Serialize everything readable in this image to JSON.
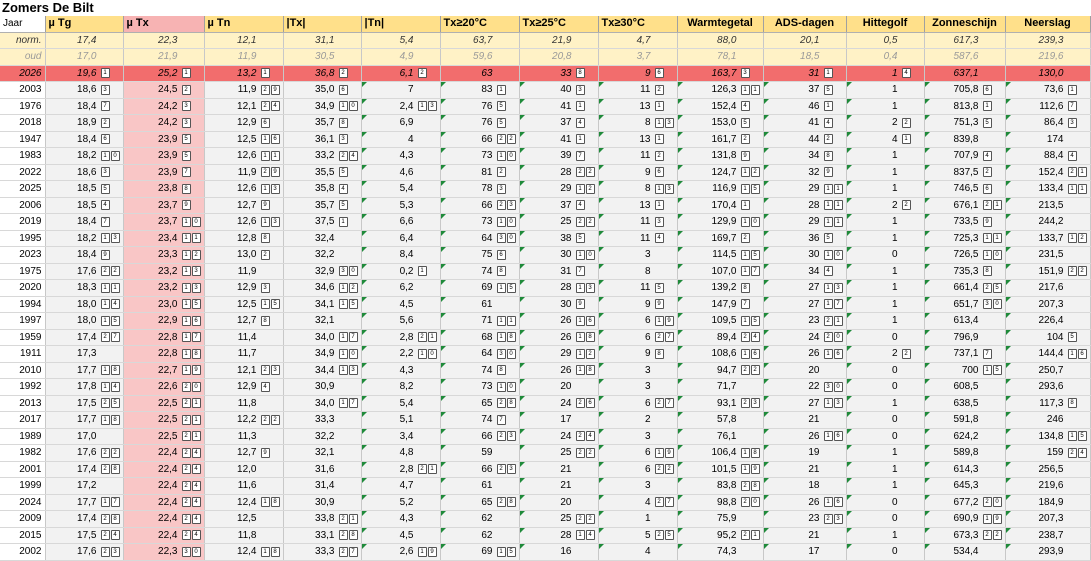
{
  "title": "Zomers De Bilt",
  "header": {
    "jaar": "Jaar",
    "columns": [
      "µ Tg",
      "µ Tx",
      "µ Tn",
      "|Tx|",
      "|Tn|",
      "Tx≥20°C",
      "Tx≥25°C",
      "Tx≥30°C",
      "Warmtegetal",
      "ADS-dagen",
      "Hittegolf",
      "Zonneschijn",
      "Neerslag"
    ]
  },
  "rows": [
    {
      "cls": "norm",
      "y": "norm.",
      "v": [
        "17,4",
        "22,3",
        "12,1",
        "31,1",
        "5,4",
        "63,7",
        "21,9",
        "4,7",
        "88,0",
        "20,1",
        "0,5",
        "617,3",
        "239,3"
      ],
      "r": [
        "",
        "",
        "",
        "",
        "",
        "",
        "",
        "",
        "",
        "",
        "",
        "",
        ""
      ]
    },
    {
      "cls": "oud",
      "y": "oud",
      "v": [
        "17,0",
        "21,9",
        "11,9",
        "30,5",
        "4,9",
        "59,6",
        "20,8",
        "3,7",
        "78,1",
        "18,5",
        "0,4",
        "587,6",
        "219,6"
      ],
      "r": [
        "",
        "",
        "",
        "",
        "",
        "",
        "",
        "",
        "",
        "",
        "",
        "",
        ""
      ]
    },
    {
      "cls": "cur",
      "y": "2026",
      "v": [
        "19,6",
        "25,2",
        "13,2",
        "36,8",
        "6,1",
        "63",
        "33",
        "9",
        "163,7",
        "31",
        "1",
        "637,1",
        "130,0"
      ],
      "r": [
        "1",
        "1",
        "1",
        "2",
        "2",
        "",
        "8",
        "6",
        "3",
        "1",
        "4",
        "",
        ""
      ]
    },
    {
      "cls": "",
      "y": "2003",
      "v": [
        "18,6",
        "24,5",
        "11,9",
        "35,0",
        "7",
        "83",
        "40",
        "11",
        "126,3",
        "37",
        "1",
        "705,8",
        "73,6"
      ],
      "r": [
        "3",
        "2",
        "29",
        "6",
        "",
        "1",
        "3",
        "2",
        "11",
        "5",
        "",
        "6",
        "1"
      ]
    },
    {
      "cls": "",
      "y": "1976",
      "v": [
        "18,4",
        "24,2",
        "12,1",
        "34,9",
        "2,4",
        "76",
        "41",
        "13",
        "152,4",
        "46",
        "1",
        "813,8",
        "112,6"
      ],
      "r": [
        "7",
        "3",
        "24",
        "10",
        "13",
        "5",
        "1",
        "1",
        "4",
        "1",
        "",
        "1",
        "7"
      ]
    },
    {
      "cls": "",
      "y": "2018",
      "v": [
        "18,9",
        "24,2",
        "12,9",
        "35,7",
        "6,9",
        "76",
        "37",
        "8",
        "153,0",
        "41",
        "2",
        "751,3",
        "86,4"
      ],
      "r": [
        "2",
        "3",
        "6",
        "8",
        "",
        "5",
        "4",
        "13",
        "5",
        "4",
        "2",
        "5",
        "3"
      ]
    },
    {
      "cls": "",
      "y": "1947",
      "v": [
        "18,4",
        "23,9",
        "12,5",
        "36,1",
        "4",
        "66",
        "41",
        "13",
        "161,7",
        "44",
        "4",
        "839,8",
        "174"
      ],
      "r": [
        "6",
        "5",
        "16",
        "3",
        "",
        "22",
        "1",
        "1",
        "2",
        "2",
        "1",
        "",
        ""
      ]
    },
    {
      "cls": "",
      "y": "1983",
      "v": [
        "18,2",
        "23,9",
        "12,6",
        "33,2",
        "4,3",
        "73",
        "39",
        "11",
        "131,8",
        "34",
        "1",
        "707,9",
        "88,4"
      ],
      "r": [
        "10",
        "5",
        "11",
        "24",
        "",
        "10",
        "7",
        "2",
        "9",
        "8",
        "",
        "4",
        "4"
      ]
    },
    {
      "cls": "",
      "y": "2022",
      "v": [
        "18,6",
        "23,9",
        "11,9",
        "35,5",
        "4,6",
        "81",
        "28",
        "9",
        "124,7",
        "32",
        "1",
        "837,5",
        "152,4"
      ],
      "r": [
        "3",
        "7",
        "29",
        "5",
        "",
        "2",
        "22",
        "6",
        "12",
        "9",
        "",
        "2",
        "21"
      ]
    },
    {
      "cls": "",
      "y": "2025",
      "v": [
        "18,5",
        "23,8",
        "12,6",
        "35,8",
        "5,4",
        "78",
        "29",
        "8",
        "116,9",
        "29",
        "1",
        "746,5",
        "133,4"
      ],
      "r": [
        "5",
        "8",
        "13",
        "4",
        "",
        "3",
        "12",
        "13",
        "15",
        "11",
        "",
        "6",
        "11"
      ]
    },
    {
      "cls": "",
      "y": "2006",
      "v": [
        "18,5",
        "23,7",
        "12,7",
        "35,7",
        "5,3",
        "66",
        "37",
        "13",
        "170,4",
        "28",
        "2",
        "676,1",
        "213,5"
      ],
      "r": [
        "4",
        "9",
        "9",
        "5",
        "",
        "23",
        "4",
        "1",
        "1",
        "11",
        "2",
        "21",
        ""
      ]
    },
    {
      "cls": "",
      "y": "2019",
      "v": [
        "18,4",
        "23,7",
        "12,6",
        "37,5",
        "6,6",
        "73",
        "25",
        "11",
        "129,9",
        "29",
        "1",
        "733,5",
        "244,2"
      ],
      "r": [
        "7",
        "10",
        "13",
        "1",
        "",
        "10",
        "22",
        "3",
        "10",
        "11",
        "",
        "9",
        ""
      ]
    },
    {
      "cls": "",
      "y": "1995",
      "v": [
        "18,2",
        "23,4",
        "12,8",
        "32,4",
        "6,4",
        "64",
        "38",
        "11",
        "169,7",
        "36",
        "1",
        "725,3",
        "133,7"
      ],
      "r": [
        "13",
        "11",
        "8",
        "",
        "",
        "30",
        "5",
        "4",
        "2",
        "5",
        "",
        "11",
        "12"
      ]
    },
    {
      "cls": "",
      "y": "2023",
      "v": [
        "18,4",
        "23,3",
        "13,0",
        "32,2",
        "8,4",
        "75",
        "30",
        "3",
        "114,5",
        "30",
        "0",
        "726,5",
        "231,5"
      ],
      "r": [
        "9",
        "12",
        "2",
        "",
        "",
        "6",
        "10",
        "",
        "15",
        "10",
        "",
        "10",
        ""
      ]
    },
    {
      "cls": "",
      "y": "1975",
      "v": [
        "17,6",
        "23,2",
        "11,9",
        "32,9",
        "0,2",
        "74",
        "31",
        "8",
        "107,0",
        "34",
        "1",
        "735,3",
        "151,9"
      ],
      "r": [
        "22",
        "13",
        "",
        "30",
        "1",
        "8",
        "7",
        "",
        "17",
        "4",
        "",
        "8",
        "22"
      ]
    },
    {
      "cls": "",
      "y": "2020",
      "v": [
        "18,3",
        "23,2",
        "12,9",
        "34,6",
        "6,2",
        "69",
        "28",
        "11",
        "139,2",
        "27",
        "1",
        "661,4",
        "217,6"
      ],
      "r": [
        "11",
        "13",
        "3",
        "12",
        "",
        "15",
        "13",
        "5",
        "8",
        "13",
        "",
        "25",
        ""
      ]
    },
    {
      "cls": "",
      "y": "1994",
      "v": [
        "18,0",
        "23,0",
        "12,5",
        "34,1",
        "4,5",
        "61",
        "30",
        "9",
        "147,9",
        "27",
        "1",
        "651,7",
        "207,3"
      ],
      "r": [
        "14",
        "15",
        "15",
        "15",
        "",
        "",
        "9",
        "9",
        "7",
        "17",
        "",
        "30",
        ""
      ]
    },
    {
      "cls": "",
      "y": "1997",
      "v": [
        "18,0",
        "22,9",
        "12,7",
        "32,1",
        "5,6",
        "71",
        "26",
        "6",
        "109,5",
        "23",
        "1",
        "613,4",
        "226,4"
      ],
      "r": [
        "15",
        "16",
        "8",
        "",
        "",
        "11",
        "16",
        "19",
        "15",
        "21",
        "",
        "",
        ""
      ]
    },
    {
      "cls": "",
      "y": "1959",
      "v": [
        "17,4",
        "22,8",
        "11,4",
        "34,0",
        "2,8",
        "68",
        "26",
        "6",
        "89,4",
        "24",
        "0",
        "796,9",
        "104"
      ],
      "r": [
        "27",
        "17",
        "",
        "17",
        "21",
        "18",
        "18",
        "27",
        "24",
        "20",
        "",
        "",
        "5"
      ]
    },
    {
      "cls": "",
      "y": "1911",
      "v": [
        "17,3",
        "22,8",
        "11,7",
        "34,9",
        "2,2",
        "64",
        "29",
        "9",
        "108,6",
        "26",
        "2",
        "737,1",
        "144,4"
      ],
      "r": [
        "",
        "18",
        "",
        "10",
        "10",
        "30",
        "12",
        "8",
        "16",
        "16",
        "2",
        "7",
        "16"
      ]
    },
    {
      "cls": "",
      "y": "2010",
      "v": [
        "17,7",
        "22,7",
        "12,1",
        "34,4",
        "4,3",
        "74",
        "26",
        "3",
        "94,7",
        "20",
        "0",
        "700",
        "250,7"
      ],
      "r": [
        "18",
        "19",
        "23",
        "13",
        "",
        "8",
        "18",
        "",
        "22",
        "",
        "",
        "15",
        ""
      ]
    },
    {
      "cls": "",
      "y": "1992",
      "v": [
        "17,8",
        "22,6",
        "12,9",
        "30,9",
        "8,2",
        "73",
        "20",
        "3",
        "71,7",
        "22",
        "0",
        "608,5",
        "293,6"
      ],
      "r": [
        "14",
        "20",
        "4",
        "",
        "",
        "10",
        "",
        "",
        "",
        "30",
        "",
        "",
        ""
      ]
    },
    {
      "cls": "",
      "y": "2013",
      "v": [
        "17,5",
        "22,5",
        "11,8",
        "34,0",
        "5,4",
        "65",
        "24",
        "6",
        "93,1",
        "27",
        "1",
        "638,5",
        "117,3"
      ],
      "r": [
        "25",
        "21",
        "",
        "17",
        "",
        "28",
        "26",
        "27",
        "23",
        "13",
        "",
        "",
        "8"
      ]
    },
    {
      "cls": "",
      "y": "2017",
      "v": [
        "17,7",
        "22,5",
        "12,2",
        "33,3",
        "5,1",
        "74",
        "17",
        "2",
        "57,8",
        "21",
        "0",
        "591,8",
        "246"
      ],
      "r": [
        "18",
        "21",
        "22",
        "",
        "",
        "7",
        "",
        "",
        "",
        "",
        "",
        "",
        ""
      ]
    },
    {
      "cls": "",
      "y": "1989",
      "v": [
        "17,0",
        "22,5",
        "11,3",
        "32,2",
        "3,4",
        "66",
        "24",
        "3",
        "76,1",
        "26",
        "0",
        "624,2",
        "134,8"
      ],
      "r": [
        "",
        "21",
        "",
        "",
        "",
        "23",
        "24",
        "",
        "",
        "16",
        "",
        "",
        "15"
      ]
    },
    {
      "cls": "",
      "y": "1982",
      "v": [
        "17,6",
        "22,4",
        "12,7",
        "32,1",
        "4,8",
        "59",
        "25",
        "6",
        "106,4",
        "19",
        "1",
        "589,8",
        "159"
      ],
      "r": [
        "22",
        "24",
        "9",
        "",
        "",
        "",
        "22",
        "19",
        "18",
        "",
        "",
        "",
        "24"
      ]
    },
    {
      "cls": "",
      "y": "2001",
      "v": [
        "17,4",
        "22,4",
        "12,0",
        "31,6",
        "2,8",
        "66",
        "21",
        "6",
        "101,5",
        "21",
        "1",
        "614,3",
        "256,5"
      ],
      "r": [
        "28",
        "24",
        "",
        "",
        "21",
        "23",
        "",
        "22",
        "19",
        "",
        "",
        "",
        ""
      ]
    },
    {
      "cls": "",
      "y": "1999",
      "v": [
        "17,2",
        "22,4",
        "11,6",
        "31,4",
        "4,7",
        "61",
        "21",
        "3",
        "83,8",
        "18",
        "1",
        "645,3",
        "219,6"
      ],
      "r": [
        "",
        "24",
        "",
        "",
        "",
        "",
        "",
        "",
        "28",
        "",
        "",
        "",
        ""
      ]
    },
    {
      "cls": "",
      "y": "2024",
      "v": [
        "17,7",
        "22,4",
        "12,4",
        "30,9",
        "5,2",
        "65",
        "20",
        "4",
        "98,8",
        "26",
        "0",
        "677,2",
        "184,9"
      ],
      "r": [
        "17",
        "24",
        "18",
        "",
        "",
        "28",
        "",
        "27",
        "20",
        "16",
        "",
        "20",
        ""
      ]
    },
    {
      "cls": "",
      "y": "2009",
      "v": [
        "17,4",
        "22,4",
        "12,5",
        "33,8",
        "4,3",
        "62",
        "25",
        "1",
        "75,9",
        "23",
        "0",
        "690,9",
        "207,3"
      ],
      "r": [
        "28",
        "24",
        "",
        "21",
        "",
        "",
        "22",
        "",
        "",
        "23",
        "",
        "19",
        ""
      ]
    },
    {
      "cls": "",
      "y": "2015",
      "v": [
        "17,5",
        "22,4",
        "11,8",
        "33,1",
        "4,5",
        "62",
        "28",
        "5",
        "95,2",
        "21",
        "1",
        "673,3",
        "238,7"
      ],
      "r": [
        "24",
        "24",
        "",
        "28",
        "",
        "",
        "14",
        "25",
        "21",
        "",
        "",
        "22",
        ""
      ]
    },
    {
      "cls": "",
      "y": "2002",
      "v": [
        "17,6",
        "22,3",
        "12,4",
        "33,3",
        "2,6",
        "69",
        "16",
        "4",
        "74,3",
        "17",
        "0",
        "534,4",
        "293,9"
      ],
      "r": [
        "23",
        "30",
        "18",
        "27",
        "19",
        "15",
        "",
        "",
        "",
        "",
        "",
        "",
        ""
      ]
    }
  ]
}
